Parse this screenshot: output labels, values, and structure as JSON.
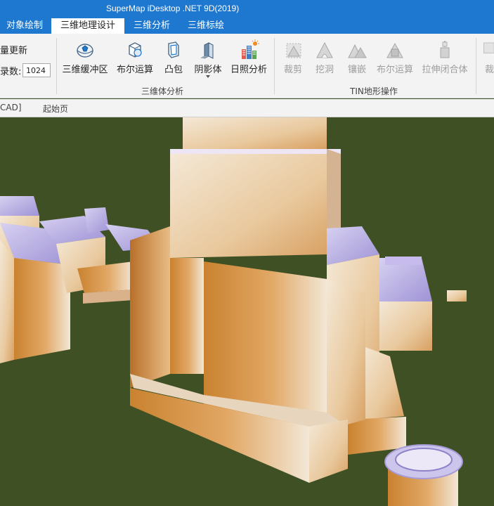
{
  "window": {
    "title": "SuperMap iDesktop .NET 9D(2019)"
  },
  "tabs": [
    {
      "label": "对象绘制",
      "active": false
    },
    {
      "label": "三维地理设计",
      "active": true
    },
    {
      "label": "三维分析",
      "active": false
    },
    {
      "label": "三维标绘",
      "active": false
    }
  ],
  "ribbon": {
    "left_partial": {
      "update_label": "量更新",
      "record_label": "录数:",
      "record_value": "1024"
    },
    "group_3d": {
      "label": "三维体分析",
      "buttons": [
        {
          "label": "三维缓冲区",
          "icon": "sphere-buffer-icon",
          "enabled": true
        },
        {
          "label": "布尔运算",
          "icon": "boolean-box-icon",
          "enabled": true
        },
        {
          "label": "凸包",
          "icon": "convex-hull-icon",
          "enabled": true
        },
        {
          "label": "阴影体",
          "icon": "shadow-volume-icon",
          "enabled": true,
          "dropdown": true
        },
        {
          "label": "日照分析",
          "icon": "sunlight-buildings-icon",
          "enabled": true
        }
      ]
    },
    "group_tin": {
      "label": "TIN地形操作",
      "buttons": [
        {
          "label": "裁剪",
          "icon": "tin-clip-icon",
          "enabled": false
        },
        {
          "label": "挖洞",
          "icon": "tin-dig-icon",
          "enabled": false
        },
        {
          "label": "镶嵌",
          "icon": "tin-mosaic-icon",
          "enabled": false
        },
        {
          "label": "布尔运算",
          "icon": "tin-boolean-icon",
          "enabled": false
        },
        {
          "label": "拉伸闭合体",
          "icon": "tin-extrude-icon",
          "enabled": false
        },
        {
          "label": "裁",
          "icon": "tin-clip-icon",
          "enabled": false
        }
      ]
    }
  },
  "document_tabs": [
    {
      "label": "CAD]"
    },
    {
      "label": "起始页"
    }
  ],
  "colors": {
    "title_bar": "#1e78cf",
    "ribbon_bg": "#f3f3f3",
    "ground": "#3f5124",
    "building_face": "#d99a54",
    "building_highlight": "#f1e6d4",
    "roof": "#b3a7e0"
  }
}
